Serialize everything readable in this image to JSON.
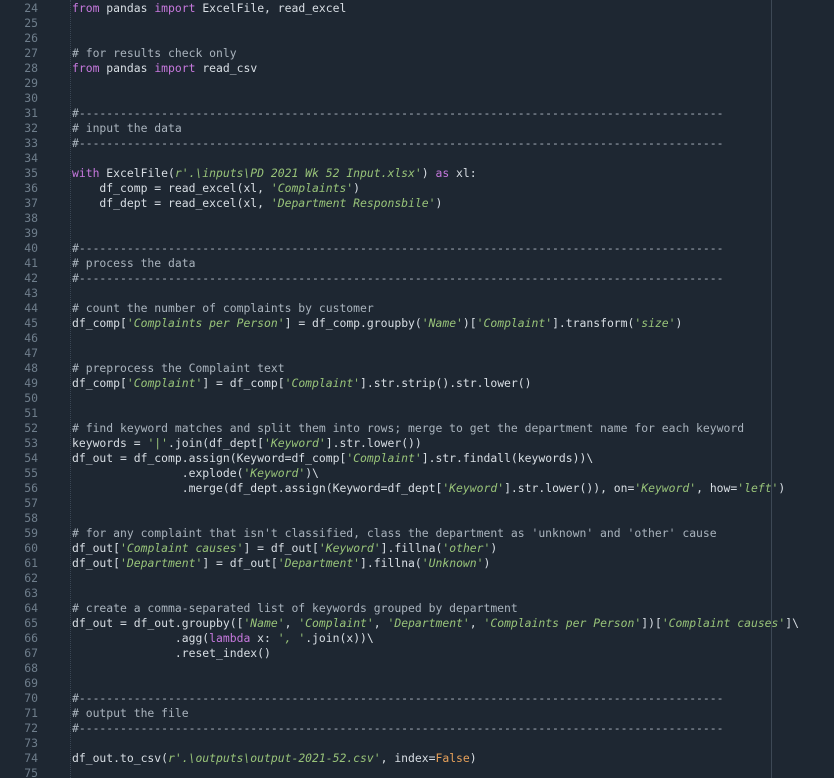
{
  "editor": {
    "colors": {
      "background": "#1e2732",
      "text": "#d8dee4",
      "keyword": "#c678dd",
      "string": "#98c379",
      "comment": "#a9b3bd",
      "line_number": "#6f7e8c",
      "constant": "#e6a05a"
    },
    "lines": [
      {
        "n": "24",
        "tokens": [
          {
            "t": "kw",
            "v": "from"
          },
          {
            "t": "p",
            "v": " pandas "
          },
          {
            "t": "kw",
            "v": "import"
          },
          {
            "t": "p",
            "v": " ExcelFile, read_excel"
          }
        ]
      },
      {
        "n": "25",
        "tokens": []
      },
      {
        "n": "26",
        "tokens": []
      },
      {
        "n": "27",
        "tokens": [
          {
            "t": "c",
            "v": "# for results check only"
          }
        ]
      },
      {
        "n": "28",
        "tokens": [
          {
            "t": "kw",
            "v": "from"
          },
          {
            "t": "p",
            "v": " pandas "
          },
          {
            "t": "kw",
            "v": "import"
          },
          {
            "t": "p",
            "v": " read_csv"
          }
        ]
      },
      {
        "n": "29",
        "tokens": []
      },
      {
        "n": "30",
        "tokens": []
      },
      {
        "n": "31",
        "tokens": [
          {
            "t": "c",
            "v": "#----------------------------------------------------------------------------------------------"
          }
        ]
      },
      {
        "n": "32",
        "tokens": [
          {
            "t": "c",
            "v": "# input the data"
          }
        ]
      },
      {
        "n": "33",
        "tokens": [
          {
            "t": "c",
            "v": "#----------------------------------------------------------------------------------------------"
          }
        ]
      },
      {
        "n": "34",
        "tokens": []
      },
      {
        "n": "35",
        "tokens": [
          {
            "t": "kw",
            "v": "with"
          },
          {
            "t": "p",
            "v": " ExcelFile("
          },
          {
            "t": "s",
            "v": "r'.\\inputs\\PD 2021 Wk 52 Input.xlsx'"
          },
          {
            "t": "p",
            "v": ") "
          },
          {
            "t": "kw",
            "v": "as"
          },
          {
            "t": "p",
            "v": " xl:"
          }
        ]
      },
      {
        "n": "36",
        "tokens": [
          {
            "t": "p",
            "v": "    df_comp = read_excel(xl, "
          },
          {
            "t": "s",
            "v": "'Complaints'"
          },
          {
            "t": "p",
            "v": ")"
          }
        ]
      },
      {
        "n": "37",
        "tokens": [
          {
            "t": "p",
            "v": "    df_dept = read_excel(xl, "
          },
          {
            "t": "s",
            "v": "'Department Responsbile'"
          },
          {
            "t": "p",
            "v": ")"
          }
        ]
      },
      {
        "n": "38",
        "tokens": []
      },
      {
        "n": "39",
        "tokens": []
      },
      {
        "n": "40",
        "tokens": [
          {
            "t": "c",
            "v": "#----------------------------------------------------------------------------------------------"
          }
        ]
      },
      {
        "n": "41",
        "tokens": [
          {
            "t": "c",
            "v": "# process the data"
          }
        ]
      },
      {
        "n": "42",
        "tokens": [
          {
            "t": "c",
            "v": "#----------------------------------------------------------------------------------------------"
          }
        ]
      },
      {
        "n": "43",
        "tokens": []
      },
      {
        "n": "44",
        "tokens": [
          {
            "t": "c",
            "v": "# count the number of complaints by customer"
          }
        ]
      },
      {
        "n": "45",
        "tokens": [
          {
            "t": "p",
            "v": "df_comp["
          },
          {
            "t": "s",
            "v": "'Complaints per Person'"
          },
          {
            "t": "p",
            "v": "] = df_comp.groupby("
          },
          {
            "t": "s",
            "v": "'Name'"
          },
          {
            "t": "p",
            "v": ")["
          },
          {
            "t": "s",
            "v": "'Complaint'"
          },
          {
            "t": "p",
            "v": "].transform("
          },
          {
            "t": "s",
            "v": "'size'"
          },
          {
            "t": "p",
            "v": ")"
          }
        ]
      },
      {
        "n": "46",
        "tokens": []
      },
      {
        "n": "47",
        "tokens": []
      },
      {
        "n": "48",
        "tokens": [
          {
            "t": "c",
            "v": "# preprocess the Complaint text"
          }
        ]
      },
      {
        "n": "49",
        "tokens": [
          {
            "t": "p",
            "v": "df_comp["
          },
          {
            "t": "s",
            "v": "'Complaint'"
          },
          {
            "t": "p",
            "v": "] = df_comp["
          },
          {
            "t": "s",
            "v": "'Complaint'"
          },
          {
            "t": "p",
            "v": "].str.strip().str.lower()"
          }
        ]
      },
      {
        "n": "50",
        "tokens": []
      },
      {
        "n": "51",
        "tokens": []
      },
      {
        "n": "52",
        "tokens": [
          {
            "t": "c",
            "v": "# find keyword matches and split them into rows; merge to get the department name for each keyword"
          }
        ]
      },
      {
        "n": "53",
        "tokens": [
          {
            "t": "p",
            "v": "keywords = "
          },
          {
            "t": "s",
            "v": "'|'"
          },
          {
            "t": "p",
            "v": ".join(df_dept["
          },
          {
            "t": "s",
            "v": "'Keyword'"
          },
          {
            "t": "p",
            "v": "].str.lower())"
          }
        ]
      },
      {
        "n": "54",
        "tokens": [
          {
            "t": "p",
            "v": "df_out = df_comp.assign(Keyword=df_comp["
          },
          {
            "t": "s",
            "v": "'Complaint'"
          },
          {
            "t": "p",
            "v": "].str.findall(keywords))\\"
          }
        ]
      },
      {
        "n": "55",
        "tokens": [
          {
            "t": "p",
            "v": "                .explode("
          },
          {
            "t": "s",
            "v": "'Keyword'"
          },
          {
            "t": "p",
            "v": ")\\"
          }
        ]
      },
      {
        "n": "56",
        "tokens": [
          {
            "t": "p",
            "v": "                .merge(df_dept.assign(Keyword=df_dept["
          },
          {
            "t": "s",
            "v": "'Keyword'"
          },
          {
            "t": "p",
            "v": "].str.lower()), on="
          },
          {
            "t": "s",
            "v": "'Keyword'"
          },
          {
            "t": "p",
            "v": ", how="
          },
          {
            "t": "s",
            "v": "'left'"
          },
          {
            "t": "p",
            "v": ")"
          }
        ]
      },
      {
        "n": "57",
        "tokens": []
      },
      {
        "n": "58",
        "tokens": []
      },
      {
        "n": "59",
        "tokens": [
          {
            "t": "c",
            "v": "# for any complaint that isn't classified, class the department as 'unknown' and 'other' cause"
          }
        ]
      },
      {
        "n": "60",
        "tokens": [
          {
            "t": "p",
            "v": "df_out["
          },
          {
            "t": "s",
            "v": "'Complaint causes'"
          },
          {
            "t": "p",
            "v": "] = df_out["
          },
          {
            "t": "s",
            "v": "'Keyword'"
          },
          {
            "t": "p",
            "v": "].fillna("
          },
          {
            "t": "s",
            "v": "'other'"
          },
          {
            "t": "p",
            "v": ")"
          }
        ]
      },
      {
        "n": "61",
        "tokens": [
          {
            "t": "p",
            "v": "df_out["
          },
          {
            "t": "s",
            "v": "'Department'"
          },
          {
            "t": "p",
            "v": "] = df_out["
          },
          {
            "t": "s",
            "v": "'Department'"
          },
          {
            "t": "p",
            "v": "].fillna("
          },
          {
            "t": "s",
            "v": "'Unknown'"
          },
          {
            "t": "p",
            "v": ")"
          }
        ]
      },
      {
        "n": "62",
        "tokens": []
      },
      {
        "n": "63",
        "tokens": []
      },
      {
        "n": "64",
        "tokens": [
          {
            "t": "c",
            "v": "# create a comma-separated list of keywords grouped by department"
          }
        ]
      },
      {
        "n": "65",
        "tokens": [
          {
            "t": "p",
            "v": "df_out = df_out.groupby(["
          },
          {
            "t": "s",
            "v": "'Name'"
          },
          {
            "t": "p",
            "v": ", "
          },
          {
            "t": "s",
            "v": "'Complaint'"
          },
          {
            "t": "p",
            "v": ", "
          },
          {
            "t": "s",
            "v": "'Department'"
          },
          {
            "t": "p",
            "v": ", "
          },
          {
            "t": "s",
            "v": "'Complaints per Person'"
          },
          {
            "t": "p",
            "v": "])["
          },
          {
            "t": "s",
            "v": "'Complaint causes'"
          },
          {
            "t": "p",
            "v": "]\\"
          }
        ]
      },
      {
        "n": "66",
        "tokens": [
          {
            "t": "p",
            "v": "               .agg("
          },
          {
            "t": "kw",
            "v": "lambda"
          },
          {
            "t": "p",
            "v": " x: "
          },
          {
            "t": "s",
            "v": "', '"
          },
          {
            "t": "p",
            "v": ".join(x))\\"
          }
        ]
      },
      {
        "n": "67",
        "tokens": [
          {
            "t": "p",
            "v": "               .reset_index()"
          }
        ]
      },
      {
        "n": "68",
        "tokens": []
      },
      {
        "n": "69",
        "tokens": []
      },
      {
        "n": "70",
        "tokens": [
          {
            "t": "c",
            "v": "#----------------------------------------------------------------------------------------------"
          }
        ]
      },
      {
        "n": "71",
        "tokens": [
          {
            "t": "c",
            "v": "# output the file"
          }
        ]
      },
      {
        "n": "72",
        "tokens": [
          {
            "t": "c",
            "v": "#----------------------------------------------------------------------------------------------"
          }
        ]
      },
      {
        "n": "73",
        "tokens": []
      },
      {
        "n": "74",
        "tokens": [
          {
            "t": "p",
            "v": "df_out.to_csv("
          },
          {
            "t": "s",
            "v": "r'.\\outputs\\output-2021-52.csv'"
          },
          {
            "t": "p",
            "v": ", index="
          },
          {
            "t": "n",
            "v": "False"
          },
          {
            "t": "p",
            "v": ")"
          }
        ]
      },
      {
        "n": "75",
        "tokens": []
      }
    ]
  }
}
